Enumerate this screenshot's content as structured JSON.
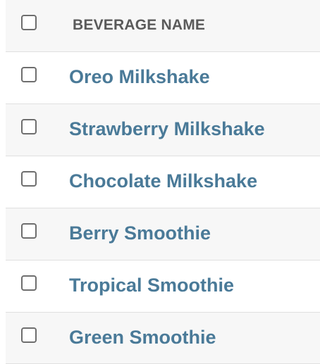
{
  "header": {
    "column_label": "BEVERAGE NAME"
  },
  "rows": [
    {
      "name": "Oreo Milkshake"
    },
    {
      "name": "Strawberry Milkshake"
    },
    {
      "name": "Chocolate Milkshake"
    },
    {
      "name": "Berry Smoothie"
    },
    {
      "name": "Tropical Smoothie"
    },
    {
      "name": "Green Smoothie"
    }
  ],
  "colors": {
    "link": "#4a7a98",
    "header_text": "#5a5a5a",
    "stripe": "#f7f7f7",
    "border": "#e0e0e0",
    "checkbox_border": "#6e6e6e"
  }
}
